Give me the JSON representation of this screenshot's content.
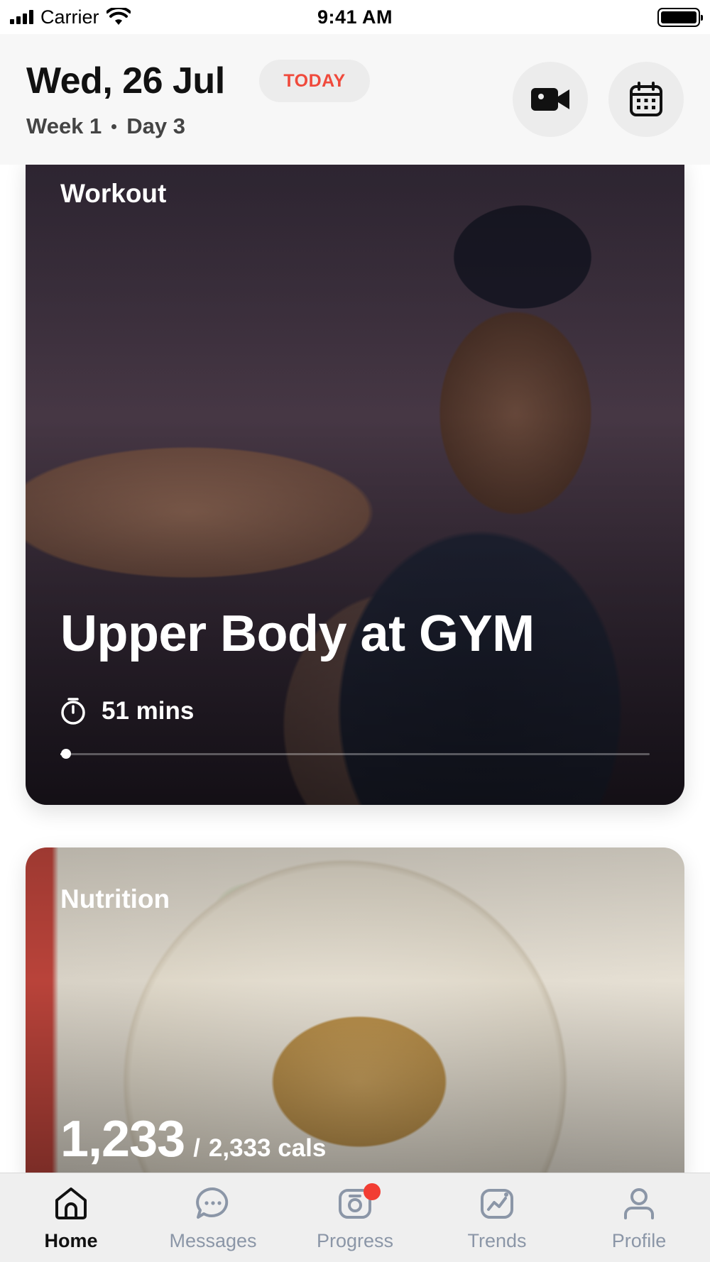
{
  "status_bar": {
    "carrier": "Carrier",
    "time": "9:41 AM"
  },
  "header": {
    "date": "Wed, 26 Jul",
    "today_badge": "TODAY",
    "week": "Week 1",
    "day": "Day 3"
  },
  "workout_card": {
    "category": "Workout",
    "title": "Upper Body at GYM",
    "duration": "51 mins",
    "progress_fraction": 0.01
  },
  "nutrition_card": {
    "category": "Nutrition",
    "calories_consumed": "1,233",
    "separator": "/",
    "calories_goal": "2,333 cals"
  },
  "tab_bar": {
    "active": "home",
    "tabs": [
      {
        "id": "home",
        "label": "Home",
        "icon": "home-icon"
      },
      {
        "id": "messages",
        "label": "Messages",
        "icon": "chat-icon"
      },
      {
        "id": "progress",
        "label": "Progress",
        "icon": "camera-icon",
        "badge": true
      },
      {
        "id": "trends",
        "label": "Trends",
        "icon": "chart-icon"
      },
      {
        "id": "profile",
        "label": "Profile",
        "icon": "person-icon"
      }
    ]
  },
  "colors": {
    "accent_red": "#f04a3c",
    "tab_inactive": "#8b96a7",
    "tab_active": "#111111",
    "badge_bg": "#ececec"
  }
}
